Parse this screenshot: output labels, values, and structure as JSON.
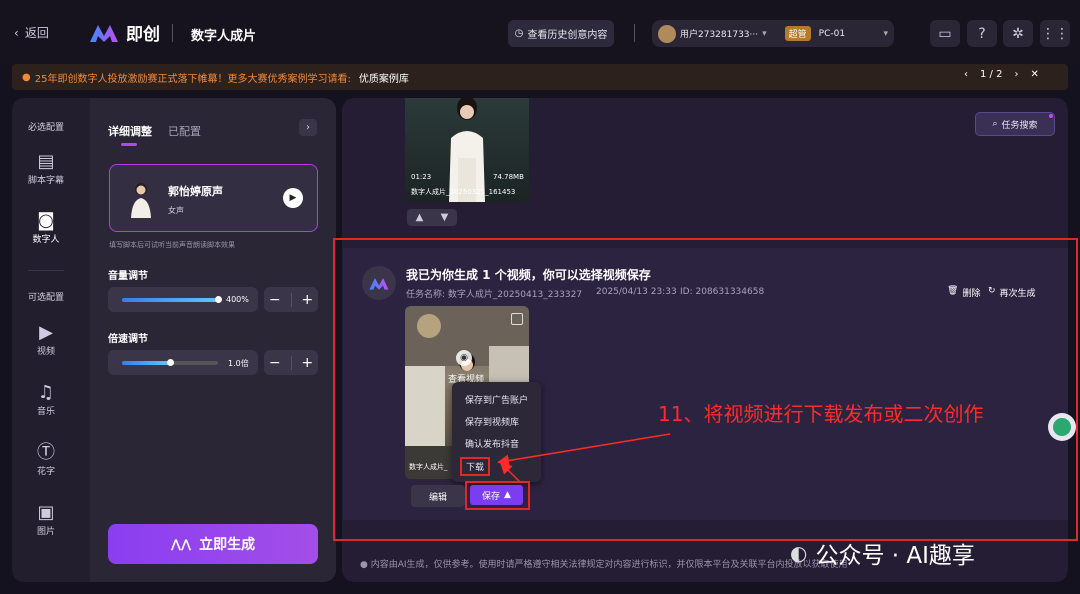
{
  "header": {
    "back_label": "返回",
    "brand_name": "即创",
    "page_title": "数字人成片",
    "history_button": "查看历史创意内容",
    "user_name": "用户273281733···",
    "role_badge": "超管",
    "device": "PC-01"
  },
  "notice": {
    "text": "25年即创数字人投放激励赛正式落下帷幕！更多大赛优秀案例学习请看:",
    "link": "优质案例库",
    "pager": "1 / 2"
  },
  "leftnav": {
    "required_heading": "必选配置",
    "optional_heading": "可选配置",
    "items": [
      {
        "label": "脚本字幕",
        "icon": "script-icon"
      },
      {
        "label": "数字人",
        "icon": "avatar-icon"
      },
      {
        "label": "视频",
        "icon": "video-icon"
      },
      {
        "label": "音乐",
        "icon": "music-icon"
      },
      {
        "label": "花字",
        "icon": "text-effect-icon"
      },
      {
        "label": "图片",
        "icon": "image-icon"
      }
    ]
  },
  "panel": {
    "tab_detail": "详细调整",
    "tab_configured": "已配置",
    "voice_name": "郭怡婷原声",
    "voice_type": "女声",
    "hint": "填写脚本后可试听当前声音朗读脚本效果",
    "volume_label": "音量调节",
    "volume_value": "400%",
    "volume_fraction": 1.0,
    "speed_label": "倍速调节",
    "speed_value": "1.0倍",
    "speed_fraction": 0.5,
    "generate_button": "立即生成"
  },
  "main": {
    "task_search": "任务搜索",
    "prev_video_duration": "01:23",
    "prev_video_size": "74.78MB",
    "prev_video_name": "数字人成片_20250325_161453",
    "message_title": "我已为你生成 1 个视频，你可以选择视频保存",
    "task_name": "任务名称: 数字人成片_20250413_233327",
    "task_time": "2025/04/13 23:33",
    "task_id": "ID: 208631334658",
    "delete_label": "删除",
    "regenerate_label": "再次生成",
    "view_video": "查看视频",
    "video2_name": "数字人成片_",
    "save_menu": [
      "保存到广告账户",
      "保存到视频库",
      "确认发布抖音",
      "下载"
    ],
    "edit_button": "编辑",
    "save_button": "保存",
    "annotation": "11、将视频进行下载发布或二次创作",
    "footer_note": "内容由AI生成，仅供参考。使用时请严格遵守相关法律规定对内容进行标识，并仅限本平台及关联平台内投放以获取使用",
    "watermark": "公众号 · AI趣享"
  },
  "colors": {
    "accent": "#8a3ef0",
    "annotation_red": "#ff2a2a",
    "notice_orange": "#f08a3a"
  }
}
